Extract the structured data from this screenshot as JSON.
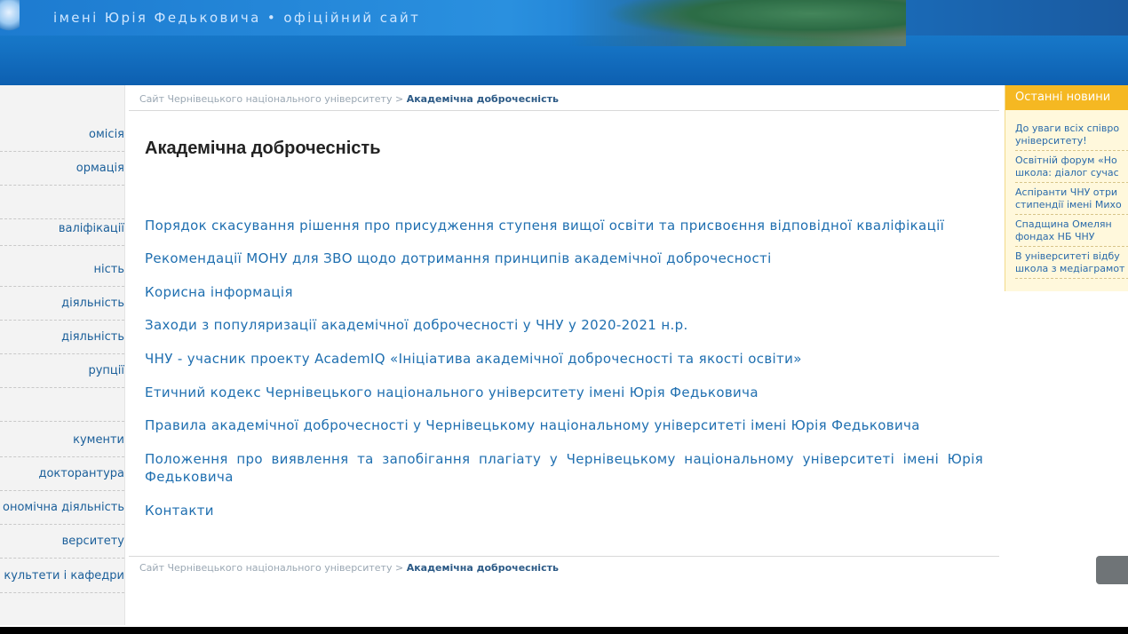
{
  "header": {
    "title": "імені Юрія Федьковича   •   офіційний сайт"
  },
  "sidebar": {
    "items": [
      {
        "label": "омісія"
      },
      {
        "label": "ормація"
      },
      {
        "label": ""
      },
      {
        "label": "валіфікації"
      },
      {
        "label": "ність"
      },
      {
        "label": "діяльність"
      },
      {
        "label": "діяльність"
      },
      {
        "label": "рупції"
      },
      {
        "label": ""
      },
      {
        "label": "кументи"
      },
      {
        "label": "докторантура"
      },
      {
        "label": "ономічна діяльність"
      },
      {
        "label": "верситету"
      },
      {
        "label": "культети і кафедри"
      }
    ]
  },
  "breadcrumb": {
    "root": "Сайт Чернівецького національного університету",
    "separator": ">",
    "current": "Академічна доброчесність"
  },
  "main": {
    "title": "Академічна доброчесність",
    "links": [
      "Порядок скасування рішення про присудження ступеня вищої освіти та присвоєння відповідної кваліфікації",
      "Рекомендації МОНУ для ЗВО щодо дотримання принципів академічної доброчесності",
      "Корисна інформація",
      "Заходи з популяризації академічної доброчесності у ЧНУ у 2020-2021 н.р.",
      "ЧНУ - учасник проекту AcademIQ «Ініціатива академічної доброчесності та якості освіти»",
      "Етичний кодекс  Чернівецького національного університету імені Юрія Федьковича",
      "Правила академічної доброчесності у Чернівецькому національному університеті імені Юрія Федьковича",
      "Положення про виявлення та запобігання плагіату у Чернівецькому національному університеті імені Юрія Федьковича",
      "Контакти"
    ]
  },
  "news": {
    "heading": "Останні новини",
    "items": [
      {
        "line1": "До уваги всіх співро",
        "line2": "університету!"
      },
      {
        "line1": "Освітній форум «Но",
        "line2": "школа: діалог сучас"
      },
      {
        "line1": "Аспіранти ЧНУ отри",
        "line2": "стипендії імені Михо"
      },
      {
        "line1": "Спадщина Омелян",
        "line2": "фондах НБ ЧНУ"
      },
      {
        "line1": "В університеті відбу",
        "line2": "школа з медіаграмот"
      }
    ]
  },
  "colors": {
    "header_blue": "#1573c4",
    "link_blue": "#1f6fb0",
    "news_header": "#f5b822",
    "news_bg": "#fff8dc"
  }
}
